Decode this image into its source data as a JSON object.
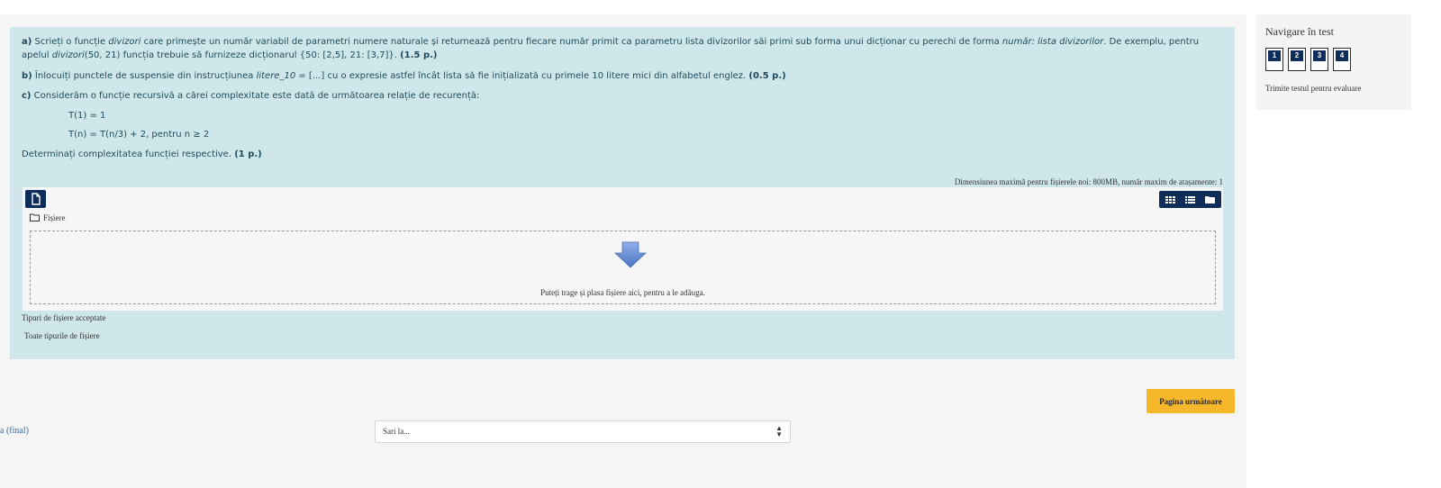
{
  "question": {
    "a_label": "a)",
    "a_text1": " Scrieți o funcție ",
    "a_func": "divizori",
    "a_text2": " care primește un număr variabil de parametri numere naturale și returnează pentru fiecare număr primit ca parametru lista divizorilor săi primi sub forma unui  dicționar cu perechi de forma ",
    "a_form": "număr: lista divizorilor",
    "a_text3": ". De exemplu, pentru apelul ",
    "a_call_func": "divizori",
    "a_text4": "(50, 21) funcția trebuie să furnizeze dicționarul {50: [2,5], 21: [3,7]}. ",
    "a_points": "(1.5 p.)",
    "b_label": "b)",
    "b_text1": " Înlocuiți punctele de suspensie din instrucțiunea ",
    "b_var": "litere_10",
    "b_text2": " = [...] cu o expresie astfel încât lista să fie inițializată cu primele 10 litere mici din alfabetul englez. ",
    "b_points": "(0.5 p.)",
    "c_label": "c)",
    "c_text": " Considerăm o funcție recursivă a cărei complexitate este dată de următoarea relație de recurență:",
    "t1": "T(1) = 1",
    "tn": "T(n) = T(n/3) + 2, pentru n ≥ 2",
    "det_text": "Determinați complexitatea funcției respective.  ",
    "det_points": "(1 p.)"
  },
  "upload": {
    "max_size": "Dimensiunea maximă pentru fișierele noi: 800MB, număr maxim de atașamente: 1",
    "folder_label": "Fișiere",
    "drop_text": "Puteți trage și plasa fișiere aici, pentru a le adăuga.",
    "types_label": "Tipuri de fișiere acceptate",
    "types_value": "Toate tipurile de fișiere"
  },
  "footer": {
    "next_label": "Pagina următoare",
    "prev_link": "a (final)",
    "jump_placeholder": "Sari la..."
  },
  "nav": {
    "title": "Navigare în test",
    "questions": [
      "1",
      "2",
      "3",
      "4"
    ],
    "submit": "Trimite testul pentru evaluare"
  },
  "colors": {
    "question_bg": "#cfe7ea",
    "navy": "#0f2d59",
    "next_button": "#f7b72a"
  }
}
